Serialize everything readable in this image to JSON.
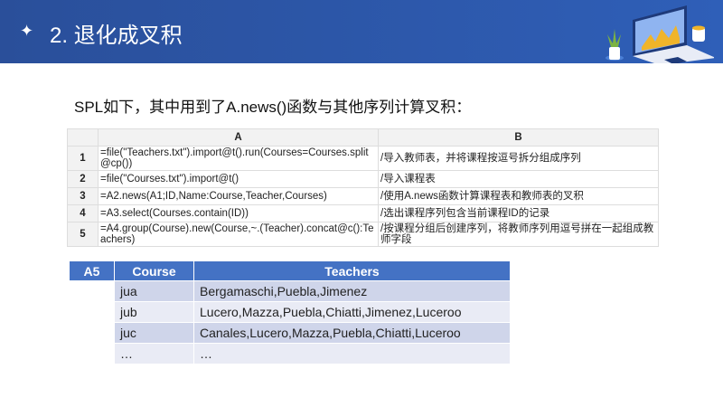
{
  "header": {
    "icon": "sparkle-icon",
    "title": "2. 退化成叉积"
  },
  "intro": "SPL如下，其中用到了A.news()函数与其他序列计算叉积：",
  "spl": {
    "col_a": "A",
    "col_b": "B",
    "rows": [
      {
        "n": "1",
        "a": "=file(\"Teachers.txt\").import@t().run(Courses=Courses.split@cp())",
        "b": "/导入教师表，并将课程按逗号拆分组成序列"
      },
      {
        "n": "2",
        "a": "=file(\"Courses.txt\").import@t()",
        "b": "/导入课程表"
      },
      {
        "n": "3",
        "a": "=A2.news(A1;ID,Name:Course,Teacher,Courses)",
        "b": "/使用A.news函数计算课程表和教师表的叉积"
      },
      {
        "n": "4",
        "a": "=A3.select(Courses.contain(ID))",
        "b": "/选出课程序列包含当前课程ID的记录"
      },
      {
        "n": "5",
        "a": "=A4.group(Course).new(Course,~.(Teacher).concat@c():Teachers)",
        "b": "/按课程分组后创建序列，将教师序列用逗号拼在一起组成教师字段"
      }
    ]
  },
  "result": {
    "headers": [
      "A5",
      "Course",
      "Teachers"
    ],
    "rows": [
      [
        "jua",
        "Bergamaschi,Puebla,Jimenez"
      ],
      [
        "jub",
        "Lucero,Mazza,Puebla,Chiatti,Jimenez,Luceroo"
      ],
      [
        "juc",
        "Canales,Lucero,Mazza,Puebla,Chiatti,Luceroo"
      ],
      [
        "…",
        "…"
      ]
    ]
  }
}
